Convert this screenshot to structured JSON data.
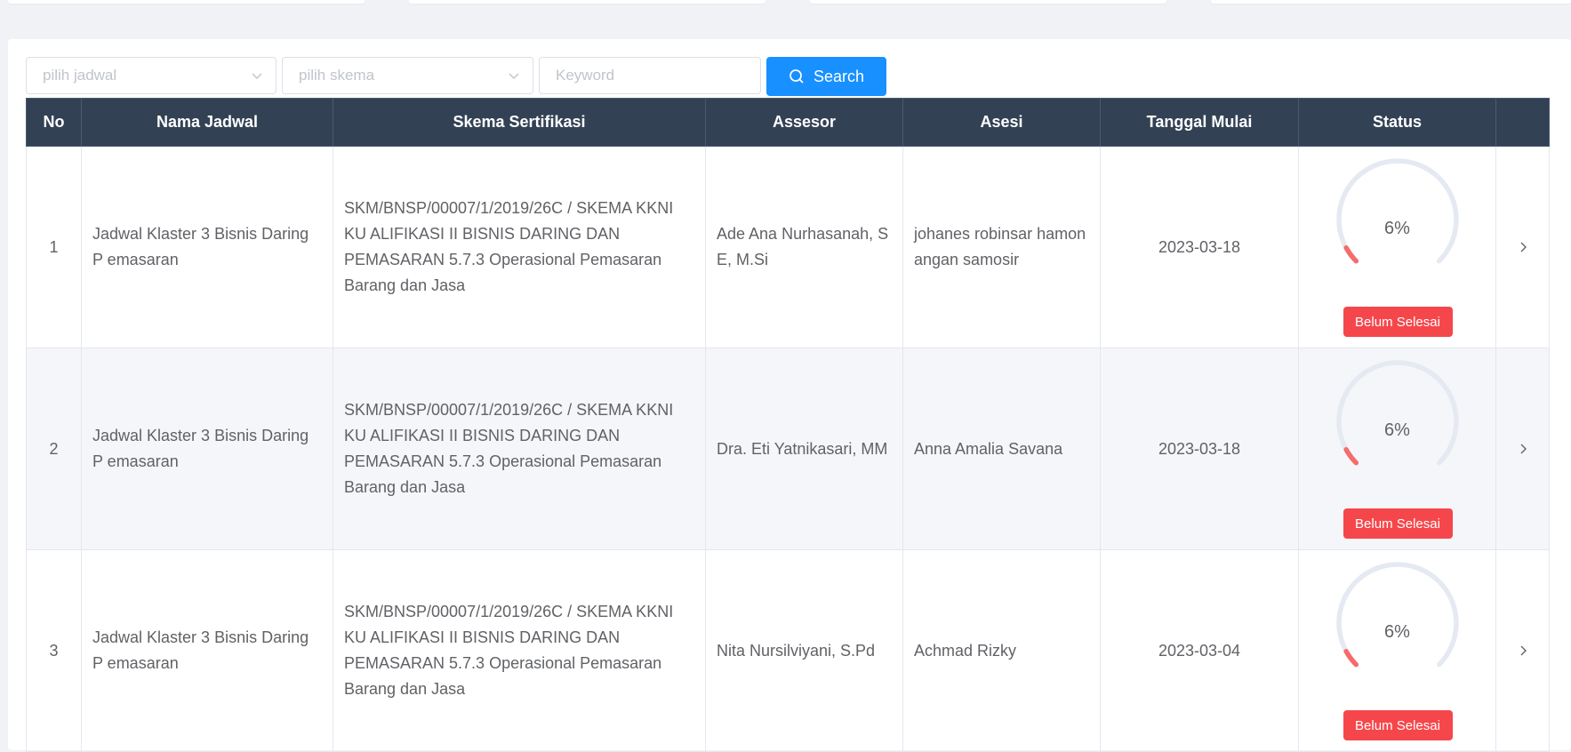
{
  "filters": {
    "jadwal_placeholder": "pilih jadwal",
    "skema_placeholder": "pilih skema",
    "keyword_placeholder": "Keyword",
    "search_label": "Search"
  },
  "table": {
    "headers": [
      "No",
      "Nama Jadwal",
      "Skema Sertifikasi",
      "Assesor",
      "Asesi",
      "Tanggal Mulai",
      "Status",
      ""
    ],
    "rows": [
      {
        "no": "1",
        "nama_jadwal": "Jadwal Klaster 3 Bisnis Daring P emasaran",
        "skema": "SKM/BNSP/00007/1/2019/26C / SKEMA KKNI KU ALIFIKASI II BISNIS DARING DAN PEMASARAN 5.7.3 Operasional Pemasaran Barang dan Jasa",
        "assesor": "Ade Ana Nurhasanah, S E, M.Si",
        "asesi": "johanes robinsar hamon angan samosir",
        "tanggal_mulai": "2023-03-18",
        "progress": "6%",
        "progress_value": 0.06,
        "status": "Belum Selesai"
      },
      {
        "no": "2",
        "nama_jadwal": "Jadwal Klaster 3 Bisnis Daring P emasaran",
        "skema": "SKM/BNSP/00007/1/2019/26C / SKEMA KKNI KU ALIFIKASI II BISNIS DARING DAN PEMASARAN 5.7.3 Operasional Pemasaran Barang dan Jasa",
        "assesor": "Dra. Eti Yatnikasari, MM",
        "asesi": "Anna Amalia Savana",
        "tanggal_mulai": "2023-03-18",
        "progress": "6%",
        "progress_value": 0.06,
        "status": "Belum Selesai"
      },
      {
        "no": "3",
        "nama_jadwal": "Jadwal Klaster 3 Bisnis Daring P emasaran",
        "skema": "SKM/BNSP/00007/1/2019/26C / SKEMA KKNI KU ALIFIKASI II BISNIS DARING DAN PEMASARAN 5.7.3 Operasional Pemasaran Barang dan Jasa",
        "assesor": "Nita Nursilviyani, S.Pd",
        "asesi": "Achmad Rizky",
        "tanggal_mulai": "2023-03-04",
        "progress": "6%",
        "progress_value": 0.06,
        "status": "Belum Selesai"
      }
    ]
  },
  "colors": {
    "header_bg": "#334155",
    "search_button": "#1890ff",
    "badge_danger": "#f5474b",
    "gauge_track": "#e5e9f2",
    "gauge_fill": "#f56c6c"
  },
  "icons": {
    "search": "search-icon",
    "dropdown": "chevron-down-icon",
    "row_action": "chevron-right-icon"
  }
}
